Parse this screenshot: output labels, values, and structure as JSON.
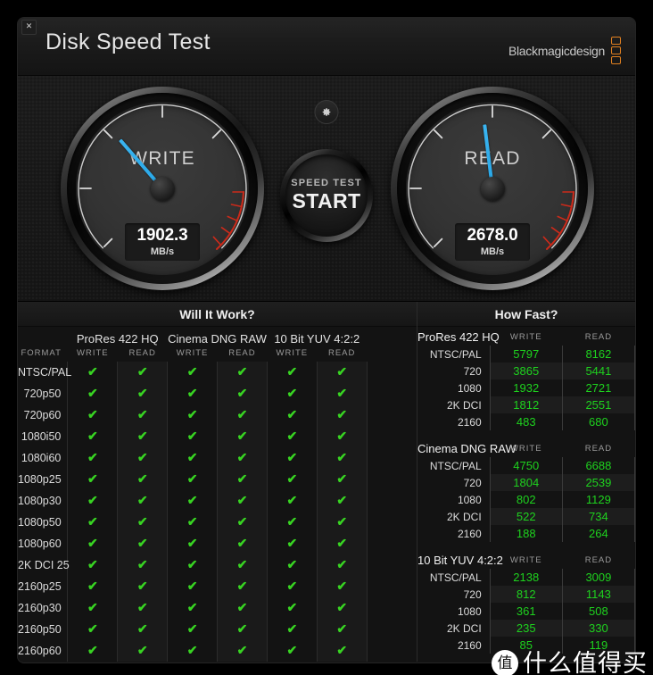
{
  "window": {
    "close_label": "✕",
    "title": "Disk Speed Test",
    "brand": "Blackmagicdesign"
  },
  "gauges": {
    "write": {
      "label": "WRITE",
      "value": "1902.3",
      "unit": "MB/s",
      "needle_angle_deg": -41
    },
    "read": {
      "label": "READ",
      "value": "2678.0",
      "unit": "MB/s",
      "needle_angle_deg": -7
    }
  },
  "center": {
    "settings_icon": "gear-icon",
    "start_line1": "SPEED TEST",
    "start_line2": "START"
  },
  "will_it_work": {
    "title": "Will It Work?",
    "format_col_header": "FORMAT",
    "groups": [
      "ProRes 422 HQ",
      "Cinema DNG RAW",
      "10 Bit YUV 4:2:2"
    ],
    "sub_headers": [
      "WRITE",
      "READ"
    ],
    "tick_glyph": "✔",
    "tick_color": "#38d422",
    "rows": [
      {
        "format": "NTSC/PAL",
        "cells": [
          true,
          true,
          true,
          true,
          true,
          true
        ]
      },
      {
        "format": "720p50",
        "cells": [
          true,
          true,
          true,
          true,
          true,
          true
        ]
      },
      {
        "format": "720p60",
        "cells": [
          true,
          true,
          true,
          true,
          true,
          true
        ]
      },
      {
        "format": "1080i50",
        "cells": [
          true,
          true,
          true,
          true,
          true,
          true
        ]
      },
      {
        "format": "1080i60",
        "cells": [
          true,
          true,
          true,
          true,
          true,
          true
        ]
      },
      {
        "format": "1080p25",
        "cells": [
          true,
          true,
          true,
          true,
          true,
          true
        ]
      },
      {
        "format": "1080p30",
        "cells": [
          true,
          true,
          true,
          true,
          true,
          true
        ]
      },
      {
        "format": "1080p50",
        "cells": [
          true,
          true,
          true,
          true,
          true,
          true
        ]
      },
      {
        "format": "1080p60",
        "cells": [
          true,
          true,
          true,
          true,
          true,
          true
        ]
      },
      {
        "format": "2K DCI 25",
        "cells": [
          true,
          true,
          true,
          true,
          true,
          true
        ]
      },
      {
        "format": "2160p25",
        "cells": [
          true,
          true,
          true,
          true,
          true,
          true
        ]
      },
      {
        "format": "2160p30",
        "cells": [
          true,
          true,
          true,
          true,
          true,
          true
        ]
      },
      {
        "format": "2160p50",
        "cells": [
          true,
          true,
          true,
          true,
          true,
          true
        ]
      },
      {
        "format": "2160p60",
        "cells": [
          true,
          true,
          true,
          true,
          true,
          true
        ]
      }
    ]
  },
  "how_fast": {
    "title": "How Fast?",
    "col_write": "WRITE",
    "col_read": "READ",
    "groups": [
      {
        "name": "ProRes 422 HQ",
        "rows": [
          {
            "label": "NTSC/PAL",
            "write": "5797",
            "read": "8162"
          },
          {
            "label": "720",
            "write": "3865",
            "read": "5441"
          },
          {
            "label": "1080",
            "write": "1932",
            "read": "2721"
          },
          {
            "label": "2K DCI",
            "write": "1812",
            "read": "2551"
          },
          {
            "label": "2160",
            "write": "483",
            "read": "680"
          }
        ]
      },
      {
        "name": "Cinema DNG RAW",
        "rows": [
          {
            "label": "NTSC/PAL",
            "write": "4750",
            "read": "6688"
          },
          {
            "label": "720",
            "write": "1804",
            "read": "2539"
          },
          {
            "label": "1080",
            "write": "802",
            "read": "1129"
          },
          {
            "label": "2K DCI",
            "write": "522",
            "read": "734"
          },
          {
            "label": "2160",
            "write": "188",
            "read": "264"
          }
        ]
      },
      {
        "name": "10 Bit YUV 4:2:2",
        "rows": [
          {
            "label": "NTSC/PAL",
            "write": "2138",
            "read": "3009"
          },
          {
            "label": "720",
            "write": "812",
            "read": "1143"
          },
          {
            "label": "1080",
            "write": "361",
            "read": "508"
          },
          {
            "label": "2K DCI",
            "write": "235",
            "read": "330"
          },
          {
            "label": "2160",
            "write": "85",
            "read": "119"
          }
        ]
      }
    ]
  },
  "watermark": {
    "badge": "值",
    "text": "什么值得买"
  }
}
